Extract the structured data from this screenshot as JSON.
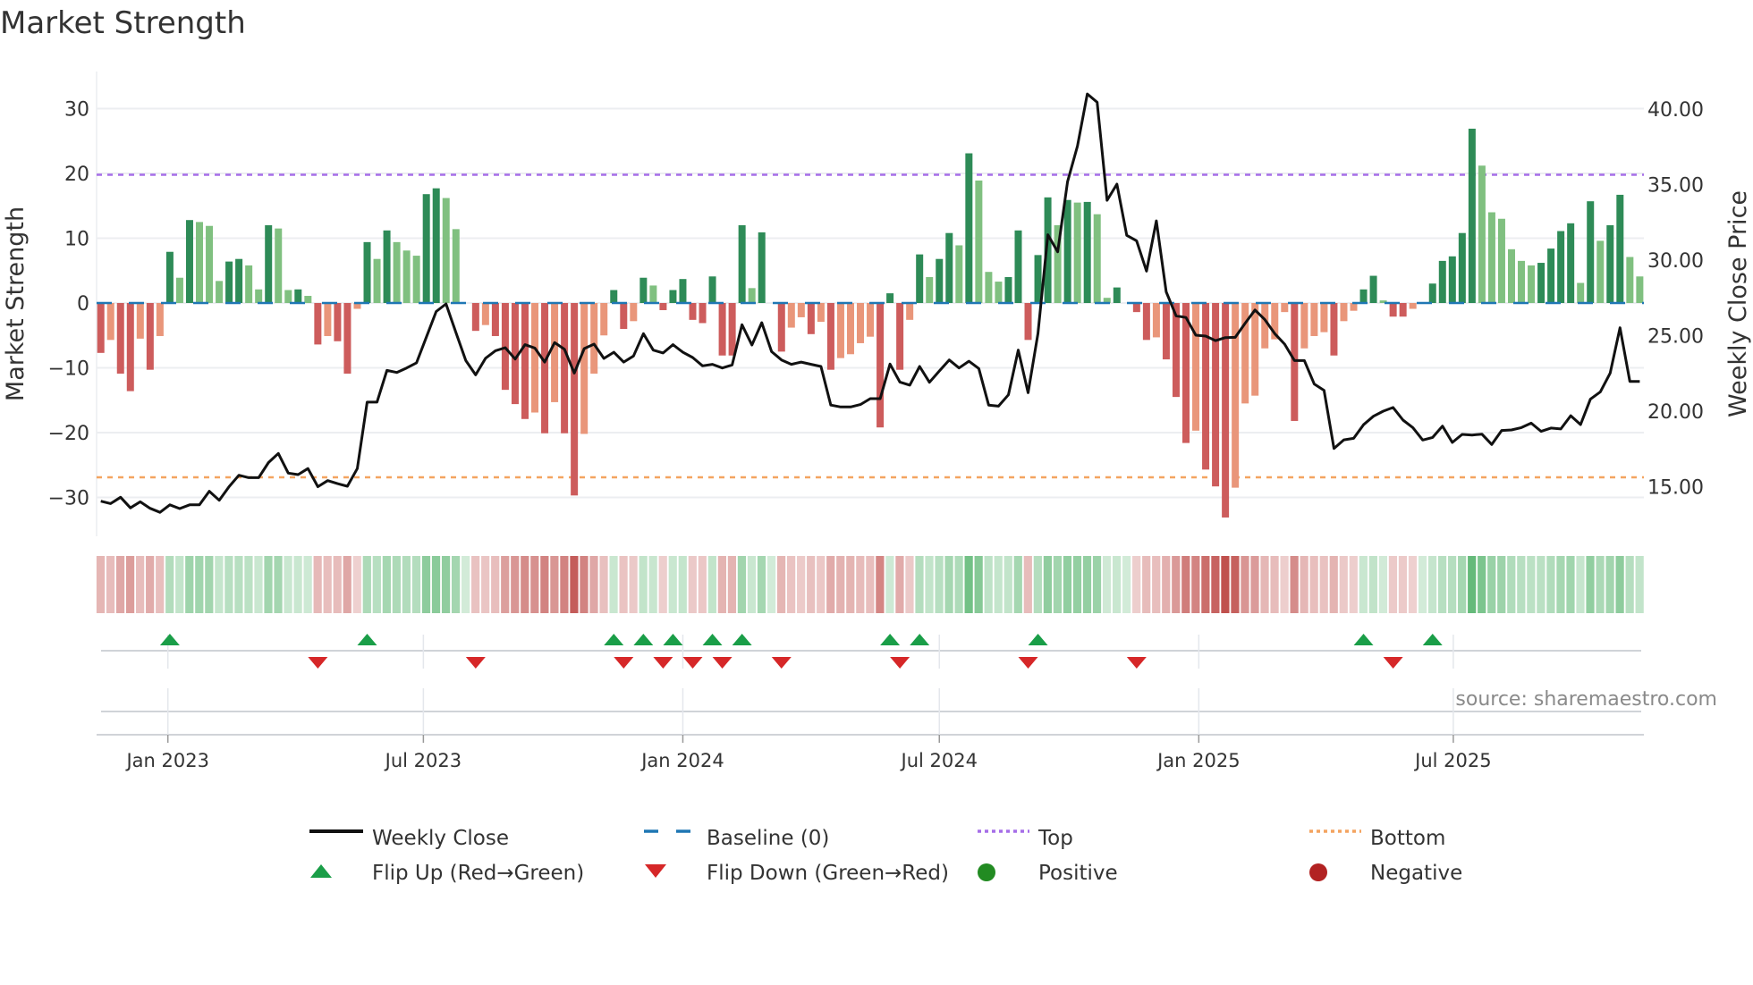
{
  "title": "Market Strength",
  "source": "source: sharemaestro.com",
  "chart_data": {
    "type": "bar",
    "title": "Market Strength",
    "ylabel": "Market Strength",
    "y2label": "Weekly Close Price",
    "ylim": [
      -36,
      36
    ],
    "y2lim": [
      12.6,
      44.2
    ],
    "yticks": [
      "30",
      "20",
      "10",
      "0",
      "−10",
      "−20",
      "−30"
    ],
    "ytick_values": [
      30,
      20,
      10,
      0,
      -10,
      -20,
      -30
    ],
    "y2ticks": [
      "40.00",
      "35.00",
      "30.00",
      "25.00",
      "20.00",
      "15.00"
    ],
    "y2tick_values": [
      40,
      35,
      30,
      25,
      20,
      15
    ],
    "x_ticks": [
      {
        "label": "Jan 2023",
        "week": 6.8
      },
      {
        "label": "Jul 2023",
        "week": 32.7
      },
      {
        "label": "Jan 2024",
        "week": 59.0
      },
      {
        "label": "Jul 2024",
        "week": 85.0
      },
      {
        "label": "Jan 2025",
        "week": 111.3
      },
      {
        "label": "Jul 2025",
        "week": 137.1
      }
    ],
    "top_level": 19.8,
    "bottom_level": -26.9,
    "baseline": 0,
    "grid": true,
    "strength": [
      -7.7,
      -5.7,
      -10.9,
      -13.6,
      -5.5,
      -10.3,
      -5.1,
      7.9,
      3.9,
      12.8,
      12.5,
      11.9,
      3.4,
      6.4,
      6.8,
      5.8,
      2.1,
      12.0,
      11.5,
      2.0,
      2.1,
      1.1,
      -6.4,
      -5.1,
      -5.9,
      -10.9,
      -0.9,
      9.4,
      6.8,
      11.2,
      9.4,
      8.1,
      7.3,
      16.8,
      17.7,
      16.2,
      11.4,
      0,
      -4.3,
      -3.4,
      -5.1,
      -13.4,
      -15.6,
      -17.9,
      -16.9,
      -20.1,
      -15.3,
      -20.1,
      -29.7,
      -20.2,
      -10.9,
      -5.0,
      2.0,
      -4.0,
      -2.8,
      3.9,
      2.7,
      -1.1,
      2.0,
      3.7,
      -2.6,
      -3.1,
      4.1,
      -8.1,
      -8.1,
      12.0,
      2.3,
      10.9,
      0,
      -7.5,
      -3.8,
      -2.2,
      -4.8,
      -2.9,
      -10.3,
      -8.5,
      -7.9,
      -6.2,
      -5.2,
      -19.2,
      1.5,
      -10.3,
      -2.6,
      7.5,
      4.0,
      6.8,
      10.8,
      8.9,
      23.1,
      18.9,
      4.8,
      3.3,
      4.0,
      11.2,
      -5.7,
      7.4,
      16.3,
      12.0,
      15.9,
      15.5,
      15.6,
      13.7,
      0.8,
      2.4,
      0,
      -1.4,
      -5.7,
      -5.3,
      -8.7,
      -14.5,
      -21.6,
      -19.7,
      -25.7,
      -28.3,
      -33.1,
      -28.5,
      -15.5,
      -14.3,
      -7.0,
      -5.6,
      -1.4,
      -18.2,
      -7.0,
      -5.1,
      -4.5,
      -8.1,
      -2.8,
      -1.2,
      2.1,
      4.2,
      0.4,
      -2.1,
      -2.1,
      -0.9,
      0,
      3.0,
      6.5,
      7.2,
      10.8,
      26.9,
      21.2,
      14.0,
      13.0,
      8.3,
      6.5,
      5.8,
      6.2,
      8.4,
      11.1,
      12.3,
      3.1,
      15.7,
      9.6,
      12.0,
      16.7,
      7.1,
      4.1
    ],
    "weekly_close": [
      14.04,
      13.88,
      14.3,
      13.6,
      14.0,
      13.57,
      13.3,
      13.8,
      13.55,
      13.8,
      13.8,
      14.7,
      14.1,
      15.0,
      15.76,
      15.6,
      15.6,
      16.6,
      17.2,
      15.9,
      15.8,
      16.2,
      15.0,
      15.4,
      15.2,
      15.03,
      16.2,
      20.6,
      20.6,
      22.7,
      22.56,
      22.86,
      23.2,
      24.9,
      26.6,
      27.1,
      25.2,
      23.35,
      22.4,
      23.5,
      24.0,
      24.2,
      23.45,
      24.4,
      24.18,
      23.25,
      24.54,
      24.1,
      22.52,
      24.14,
      24.44,
      23.49,
      23.9,
      23.25,
      23.65,
      25.13,
      24.04,
      23.85,
      24.4,
      23.9,
      23.55,
      23.0,
      23.1,
      22.86,
      23.06,
      25.72,
      24.38,
      25.86,
      23.94,
      23.39,
      23.1,
      23.25,
      23.1,
      22.96,
      20.4,
      20.28,
      20.28,
      20.44,
      20.83,
      20.83,
      23.12,
      21.93,
      21.72,
      22.96,
      21.91,
      22.66,
      23.39,
      22.86,
      23.31,
      22.82,
      20.4,
      20.33,
      21.08,
      24.04,
      21.22,
      25.13,
      31.68,
      30.55,
      35.19,
      37.55,
      41.0,
      40.45,
      33.96,
      35.03,
      31.64,
      31.28,
      29.27,
      32.6,
      27.9,
      26.31,
      26.2,
      25.03,
      24.97,
      24.67,
      24.87,
      24.89,
      25.82,
      26.7,
      26.06,
      25.13,
      24.44,
      23.35,
      23.35,
      21.8,
      21.38,
      17.53,
      18.1,
      18.2,
      19.1,
      19.66,
      20.0,
      20.24,
      19.41,
      18.91,
      18.09,
      18.26,
      19.01,
      17.93,
      18.46,
      18.42,
      18.48,
      17.79,
      18.72,
      18.76,
      18.91,
      19.21,
      18.66,
      18.88,
      18.82,
      19.7,
      19.11,
      20.79,
      21.28,
      22.52,
      25.52,
      21.97,
      21.97
    ],
    "legend": [
      {
        "label": "Weekly Close",
        "symbol": "line",
        "color": "#111111"
      },
      {
        "label": "Baseline (0)",
        "symbol": "dash",
        "color": "#1f77b4"
      },
      {
        "label": "Top",
        "symbol": "dot",
        "color": "#a66ee8"
      },
      {
        "label": "Bottom",
        "symbol": "dot",
        "color": "#f4a460"
      },
      {
        "label": "Flip Up (Red→Green)",
        "symbol": "triangle-up",
        "color": "#1a9e48"
      },
      {
        "label": "Flip Down (Green→Red)",
        "symbol": "triangle-down",
        "color": "#d62728"
      },
      {
        "label": "Positive",
        "symbol": "circle",
        "color": "#228b22"
      },
      {
        "label": "Negative",
        "symbol": "circle",
        "color": "#b22222"
      }
    ],
    "legend_position": "bottom-center",
    "colors": {
      "pos_strong": "#2e8b57",
      "pos_weak": "#80c080",
      "neg_strong": "#cd5c5c",
      "neg_weak": "#e9967a",
      "heat_pos": "#4caf64",
      "heat_neg": "#c0504d"
    }
  }
}
